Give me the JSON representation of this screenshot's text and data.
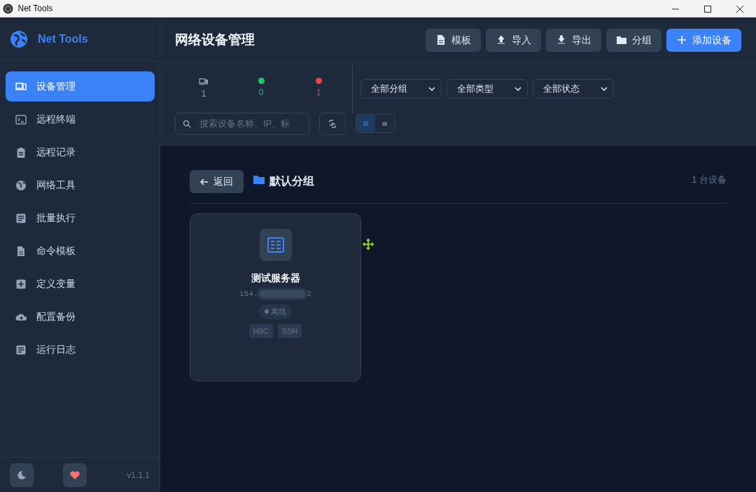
{
  "window": {
    "title": "Net Tools"
  },
  "sidebar": {
    "brand": "Net Tools",
    "items": [
      {
        "label": "设备管理",
        "selected": true
      },
      {
        "label": "远程终端",
        "selected": false
      },
      {
        "label": "远程记录",
        "selected": false
      },
      {
        "label": "网络工具",
        "selected": false
      },
      {
        "label": "批量执行",
        "selected": false
      },
      {
        "label": "命令模板",
        "selected": false
      },
      {
        "label": "定义变量",
        "selected": false
      },
      {
        "label": "配置备份",
        "selected": false
      },
      {
        "label": "运行日志",
        "selected": false
      }
    ],
    "version": "v1.1.1"
  },
  "header": {
    "title": "网络设备管理",
    "buttons": [
      {
        "label": "模板",
        "kind": "default"
      },
      {
        "label": "导入",
        "kind": "default"
      },
      {
        "label": "导出",
        "kind": "default"
      },
      {
        "label": "分组",
        "kind": "default"
      },
      {
        "label": "添加设备",
        "kind": "primary"
      }
    ]
  },
  "stats": [
    {
      "kind": "total",
      "value": "1"
    },
    {
      "kind": "online",
      "value": "0"
    },
    {
      "kind": "offline",
      "value": "1"
    }
  ],
  "filters": [
    "全部分组",
    "全部类型",
    "全部状态"
  ],
  "search": {
    "placeholder": "搜索设备名称、IP、标"
  },
  "view_modes": [
    {
      "kind": "grid",
      "selected": true
    },
    {
      "kind": "list",
      "selected": false
    }
  ],
  "group": {
    "back": "返回",
    "name": "默认分组",
    "count": "1 台设备"
  },
  "devices": [
    {
      "name": "测试服务器",
      "ip_start": "154.",
      "ip_end": "2",
      "status": "离线",
      "online": false,
      "tags": [
        "H3C",
        "SSH"
      ]
    }
  ]
}
